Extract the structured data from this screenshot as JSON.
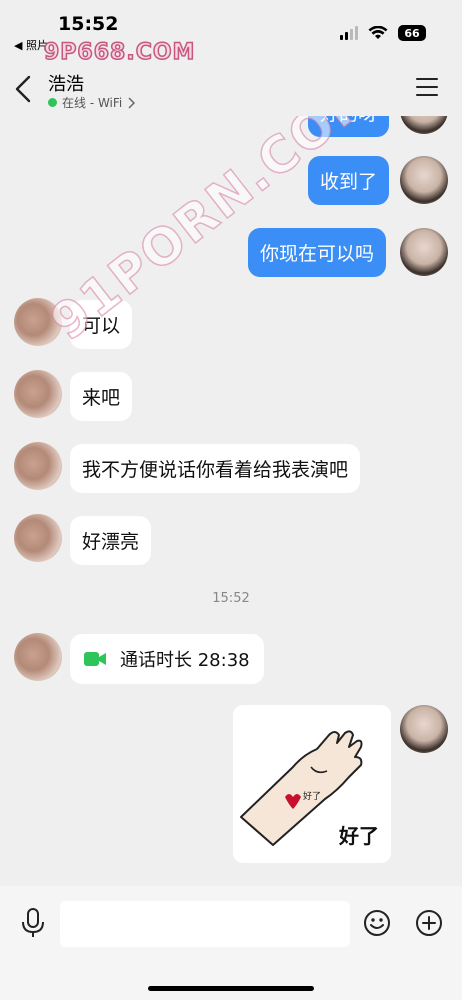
{
  "status_bar": {
    "time": "15:52",
    "back_app": "◀ 照片",
    "battery": "66"
  },
  "watermarks": {
    "top": "9P668.COM",
    "diagonal": "91PORN.COM"
  },
  "header": {
    "contact_name": "浩浩",
    "status_text": "在线 - WiFi",
    "status_color": "#2fc45a"
  },
  "messages": {
    "out_partial": "好的呀",
    "out_1": "收到了",
    "out_2": "你现在可以吗",
    "in_1": "可以",
    "in_2": "来吧",
    "in_3": "我不方便说话你看着给我表演吧",
    "in_4": "好漂亮",
    "timestamp": "15:52",
    "call_text": "通话时长 28:38",
    "sticker_caption": "好了",
    "sticker_tag": "好了"
  },
  "input": {
    "placeholder": ""
  },
  "colors": {
    "bubble_out": "#3a8ef6",
    "bubble_in": "#ffffff",
    "background": "#efefef",
    "call_icon": "#2fc45a"
  },
  "icons": {
    "back": "chevron-left-icon",
    "menu": "menu-icon",
    "mic": "microphone-icon",
    "emoji": "smiley-icon",
    "plus": "plus-circle-icon",
    "call": "video-camera-icon"
  }
}
